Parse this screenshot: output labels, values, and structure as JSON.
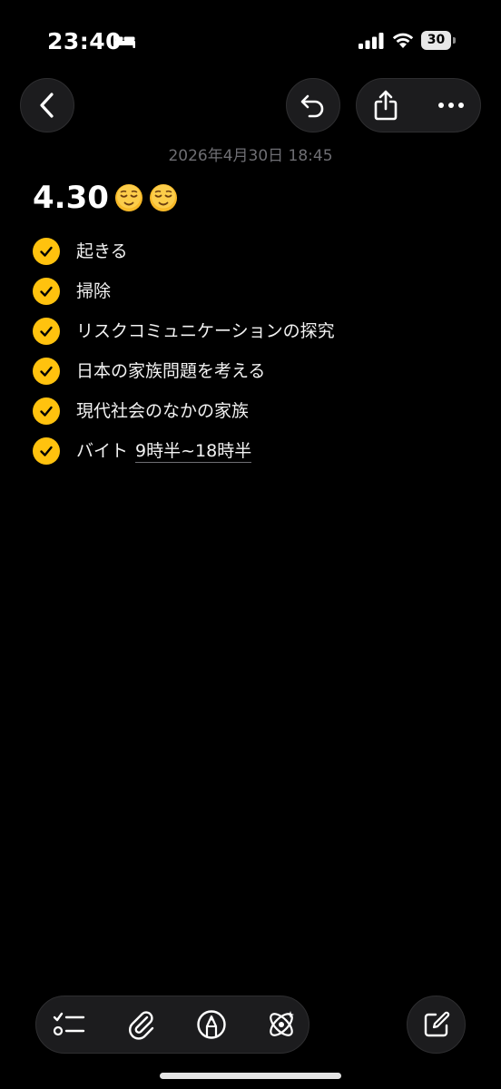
{
  "status_bar": {
    "time": "23:40",
    "battery_level": "30",
    "icons": [
      "bed-icon",
      "signal-icon",
      "wifi-icon",
      "battery-icon"
    ]
  },
  "nav": {
    "icons": [
      "chevron-left-icon",
      "undo-icon",
      "share-icon",
      "more-icon"
    ]
  },
  "note": {
    "date": "2026年4月30日 18:45",
    "title": "4.30",
    "title_emojis": [
      "relieved-face-emoji",
      "relieved-face-emoji"
    ],
    "items": [
      {
        "text": "起きる",
        "checked": true
      },
      {
        "text": "掃除",
        "checked": true
      },
      {
        "text": "リスクコミュニケーションの探究",
        "checked": true
      },
      {
        "text": "日本の家族問題を考える",
        "checked": true
      },
      {
        "text": "現代社会のなかの家族",
        "checked": true
      },
      {
        "text": "バイト",
        "time": "9時半~18時半",
        "checked": true
      }
    ]
  },
  "toolbar": {
    "icons": [
      "checklist-icon",
      "paperclip-icon",
      "markup-pen-icon",
      "apple-intelligence-icon",
      "compose-icon"
    ]
  },
  "colors": {
    "background": "#000000",
    "check_fill": "#ffc20e",
    "button_bg": "#1c1c1e",
    "date_text": "#6e6e73"
  }
}
